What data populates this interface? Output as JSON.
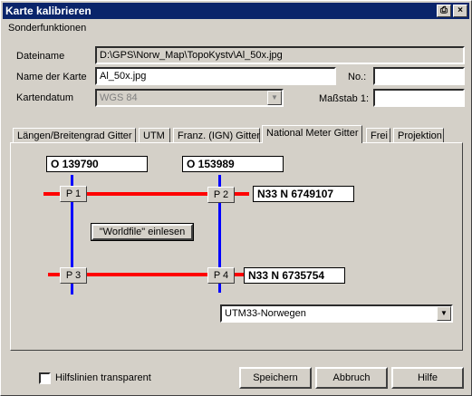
{
  "window": {
    "title": "Karte kalibrieren"
  },
  "menu": {
    "sonderfunktionen": "Sonderfunktionen"
  },
  "form": {
    "dateiname_label": "Dateiname",
    "dateiname_value": "D:\\GPS\\Norw_Map\\TopoKystv\\Al_50x.jpg",
    "name_label": "Name der Karte",
    "name_value": "Al_50x.jpg",
    "no_label": "No.:",
    "no_value": "",
    "kartendatum_label": "Kartendatum",
    "kartendatum_value": "WGS 84",
    "massstab_label": "Maßstab 1:",
    "massstab_value": ""
  },
  "tabs": [
    {
      "label": "Längen/Breitengrad Gitter"
    },
    {
      "label": "UTM"
    },
    {
      "label": "Franz. (IGN) Gitter"
    },
    {
      "label": "National Meter Gitter"
    },
    {
      "label": "Frei"
    },
    {
      "label": "Projektion"
    }
  ],
  "grid": {
    "x1": "O 139790",
    "x2": "O 153989",
    "y1": "N33 N 6749107",
    "y2": "N33 N 6735754",
    "p1": "P 1",
    "p2": "P 2",
    "p3": "P 3",
    "p4": "P 4",
    "worldfile": "\"Worldfile\" einlesen",
    "projection": "UTM33-Norwegen"
  },
  "bottom": {
    "hilfslinien": "Hilfslinien transparent",
    "speichern": "Speichern",
    "abbruch": "Abbruch",
    "hilfe": "Hilfe"
  },
  "colors": {
    "title_bg": "#0a246a",
    "line_red": "#ff0000",
    "line_blue": "#0000ff"
  }
}
